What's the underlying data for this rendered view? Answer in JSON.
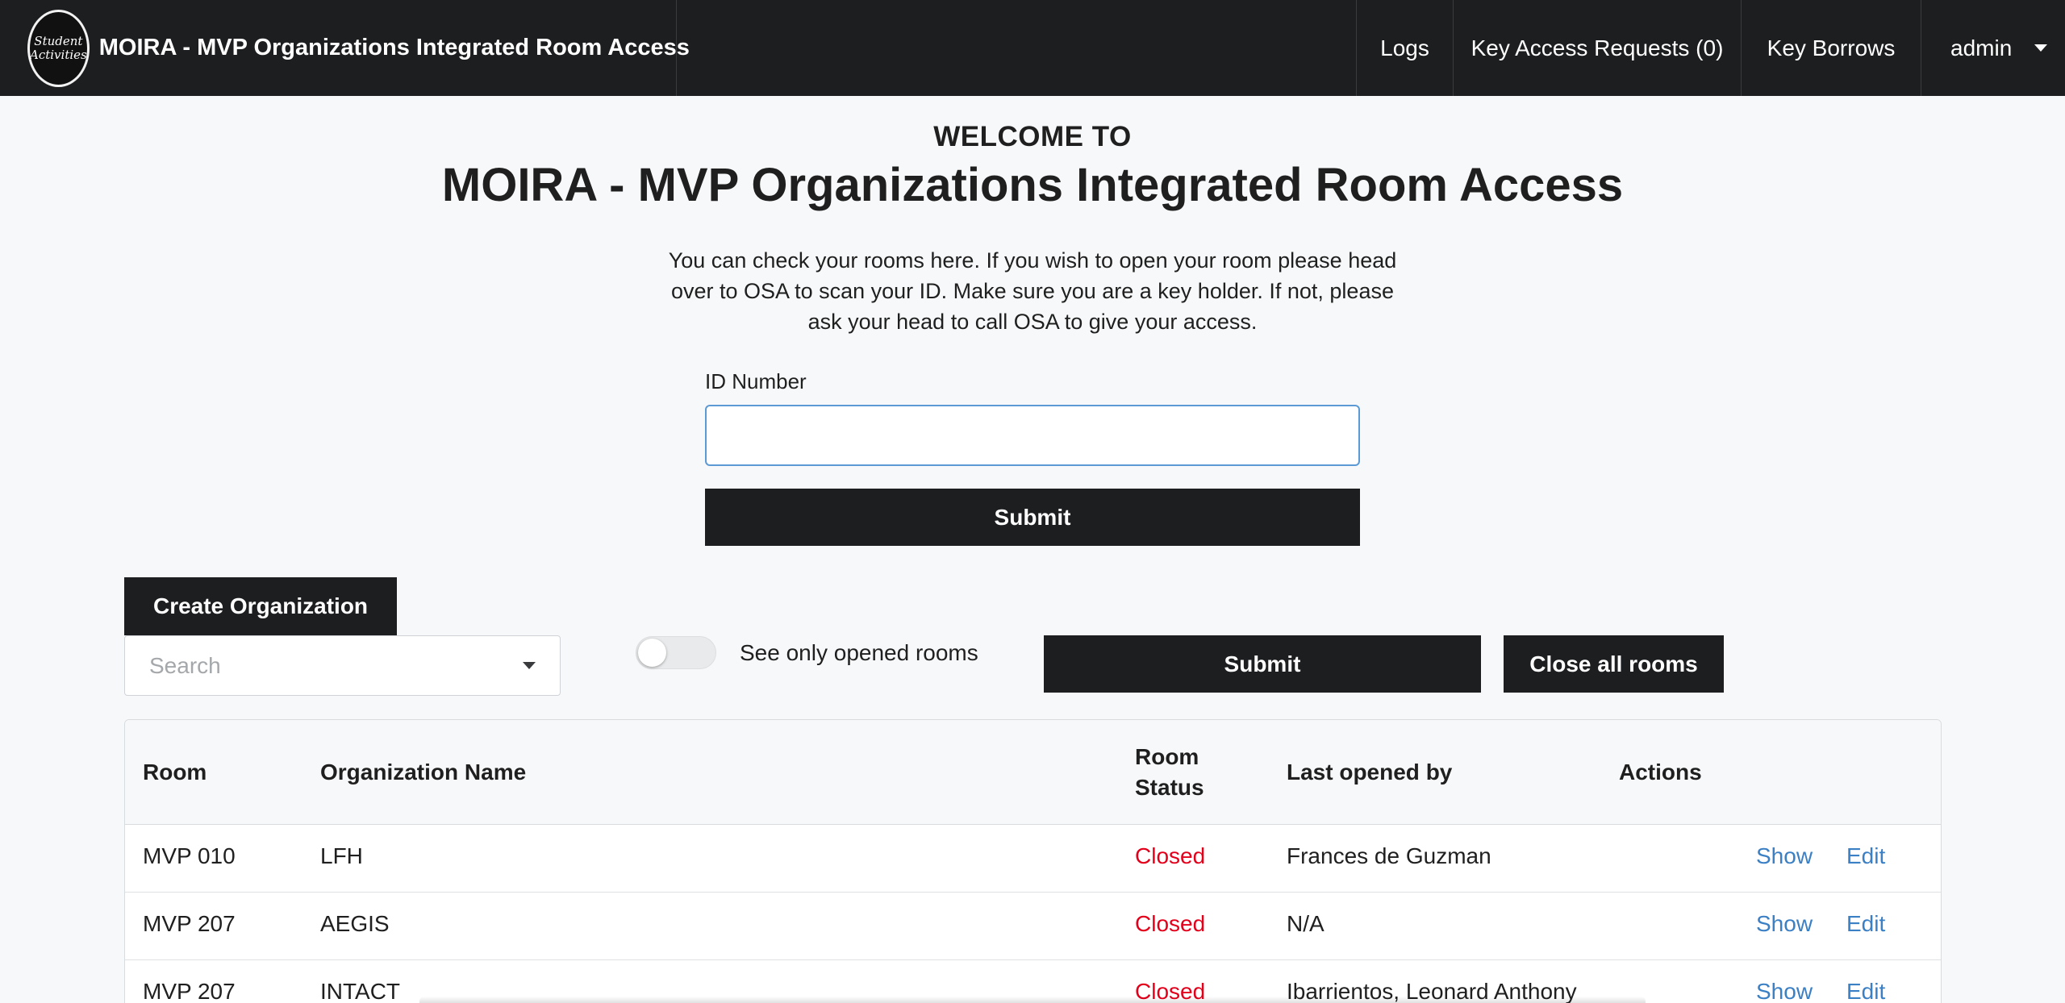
{
  "navbar": {
    "logo_text": "Student Activities",
    "brand_title": "MOIRA - MVP Organizations Integrated Room Access",
    "links": {
      "logs": "Logs",
      "key_access_requests": "Key Access Requests (0)",
      "key_borrows": "Key Borrows",
      "admin": "admin"
    }
  },
  "hero": {
    "welcome": "WELCOME TO",
    "title": "MOIRA - MVP Organizations Integrated Room Access",
    "intro": "You can check your rooms here. If you wish to open your room please head over to OSA to scan your ID. Make sure you are a key holder. If not, please ask your head to call OSA to give your access."
  },
  "id_form": {
    "label": "ID Number",
    "value": "",
    "submit_label": "Submit"
  },
  "controls": {
    "create_org_label": "Create Organization",
    "search_placeholder": "Search",
    "toggle_label": "See only opened rooms",
    "toggle_on": false,
    "submit_label": "Submit",
    "close_all_label": "Close all rooms"
  },
  "table": {
    "headers": {
      "room": "Room",
      "organization": "Organization Name",
      "status_line1": "Room",
      "status_line2": "Status",
      "last_opened": "Last opened by",
      "actions": "Actions"
    },
    "rows": [
      {
        "room": "MVP 010",
        "organization": "LFH",
        "status": "Closed",
        "last_opened_by": "Frances de Guzman",
        "show": "Show",
        "edit": "Edit"
      },
      {
        "room": "MVP 207",
        "organization": "AEGIS",
        "status": "Closed",
        "last_opened_by": "N/A",
        "show": "Show",
        "edit": "Edit"
      },
      {
        "room": "MVP 207",
        "organization": "INTACT",
        "status": "Closed",
        "last_opened_by": "Ibarrientos, Leonard Anthony",
        "show": "Show",
        "edit": "Edit"
      }
    ]
  },
  "colors": {
    "navbar_bg": "#1d1e20",
    "status_closed": "#e3001b",
    "link": "#3b7fc4",
    "input_focus_border": "#5b9ad5"
  }
}
